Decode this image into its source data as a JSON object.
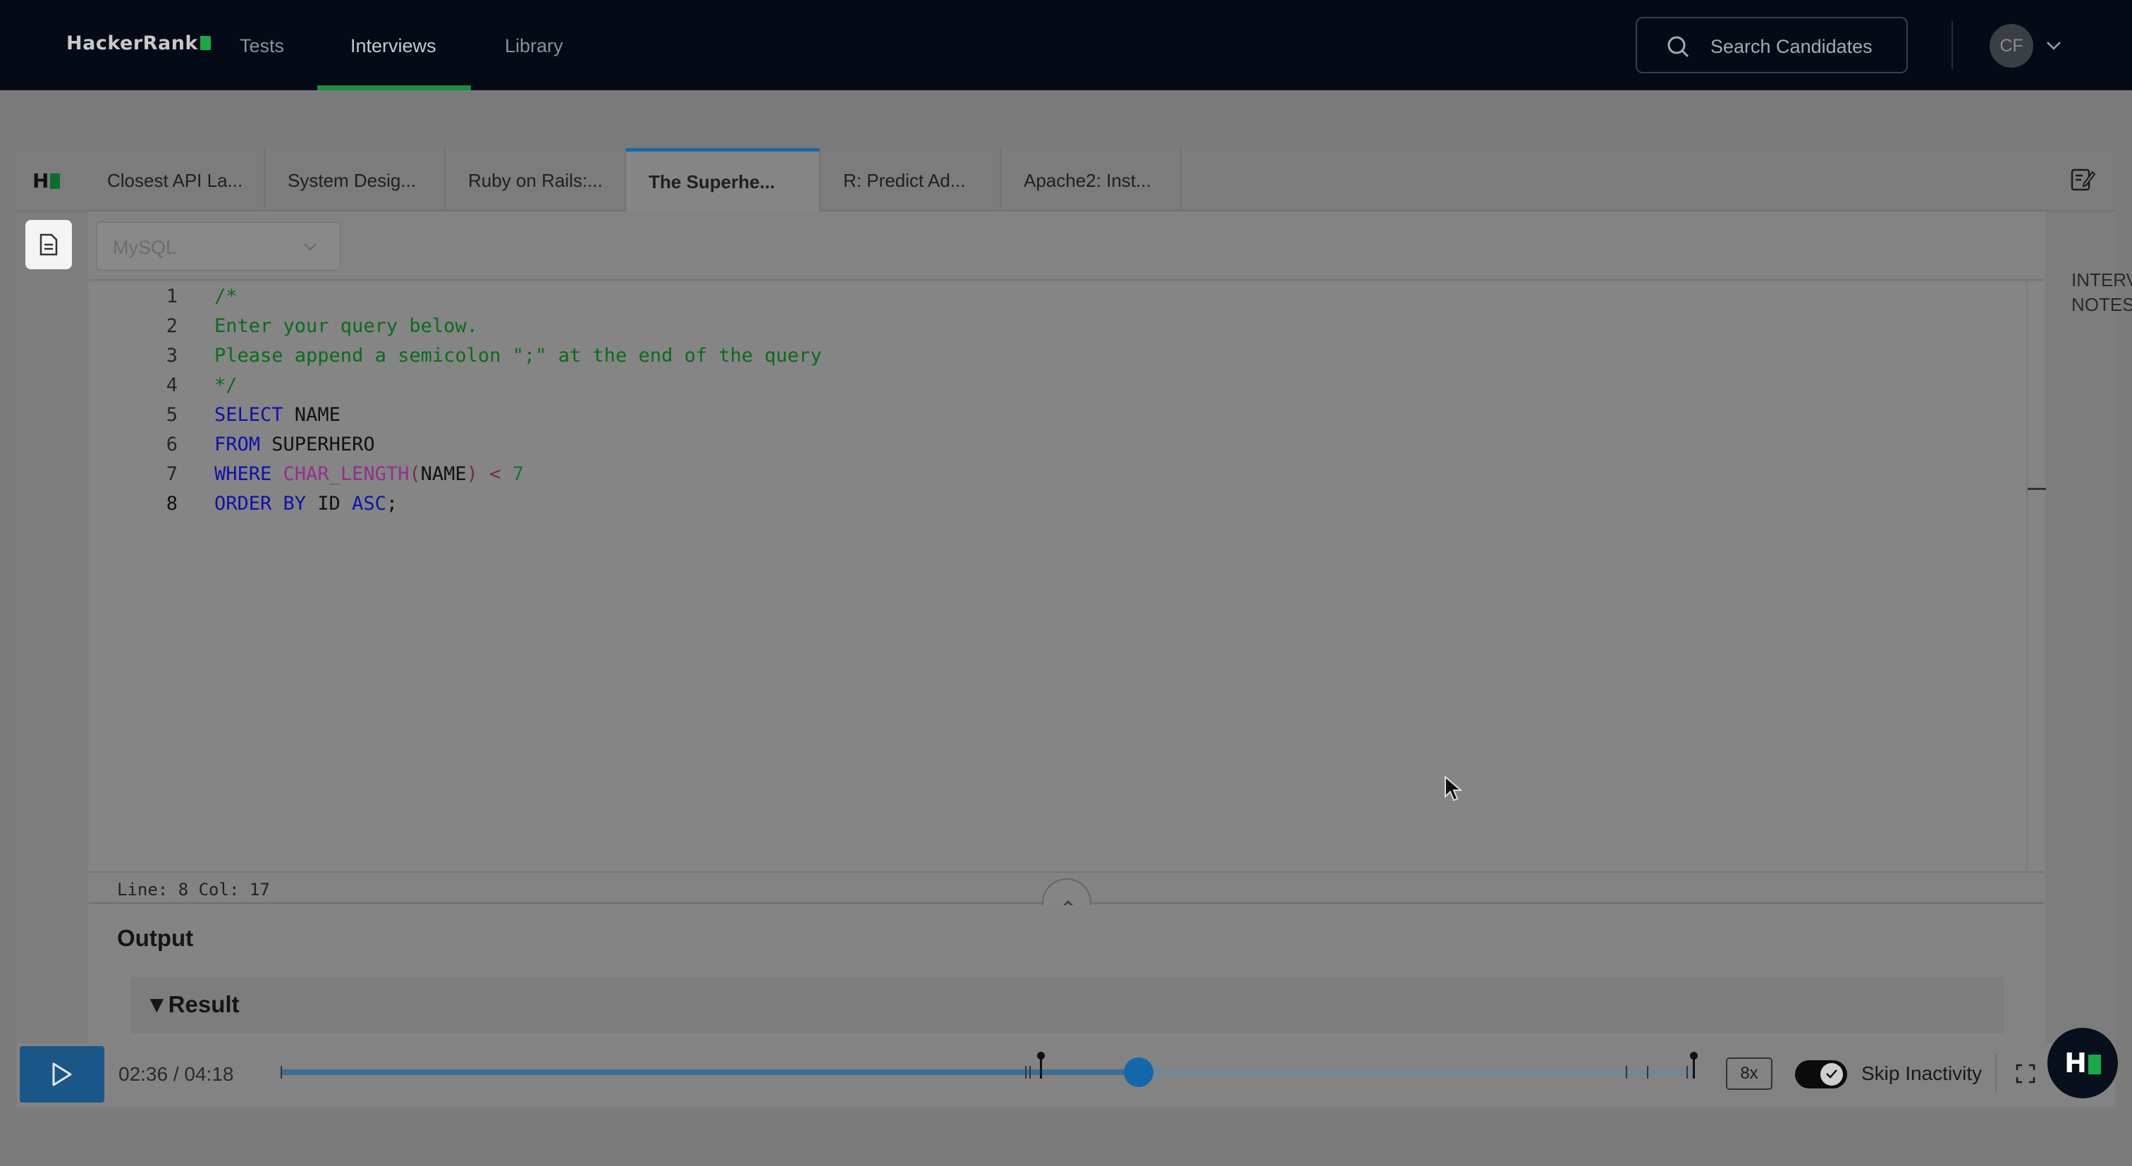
{
  "topnav": {
    "logo": "HackerRank",
    "links": [
      "Tests",
      "Interviews",
      "Library"
    ],
    "active_link": "Interviews",
    "search_placeholder": "Search Candidates",
    "avatar_initials": "CF"
  },
  "tabs": [
    {
      "label": "Closest API La..."
    },
    {
      "label": "System Desig..."
    },
    {
      "label": "Ruby on Rails:..."
    },
    {
      "label": "The Superhe...",
      "active": true
    },
    {
      "label": "R: Predict Ad..."
    },
    {
      "label": "Apache2: Inst..."
    }
  ],
  "editor": {
    "language": "MySQL",
    "lines": [
      {
        "n": "1",
        "text": "/*"
      },
      {
        "n": "2",
        "text": "Enter your query below."
      },
      {
        "n": "3",
        "text": "Please append a semicolon \";\" at the end of the query"
      },
      {
        "n": "4",
        "text": "*/"
      },
      {
        "n": "5",
        "kw1": "SELECT",
        "rest": " NAME"
      },
      {
        "n": "6",
        "kw1": "FROM",
        "rest": " SUPERHERO"
      },
      {
        "n": "7",
        "kw1": "WHERE",
        "fn": "CHAR_LENGTH",
        "arg": "NAME",
        "op": " < ",
        "num": "7"
      },
      {
        "n": "8",
        "kw1": "ORDER BY",
        "id": " ID ",
        "kw2": "ASC",
        "end": ";"
      }
    ],
    "status": "Line: 8 Col: 17"
  },
  "notes_rail_label": "INTERVIEWER NOTES",
  "output": {
    "title": "Output",
    "result_label": "Result"
  },
  "player": {
    "time": "02:36 / 04:18",
    "progress_fraction": 0.605,
    "speed": "8x",
    "skip_inactivity_label": "Skip Inactivity",
    "skip_inactivity_on": true
  },
  "colors": {
    "accent_green": "#1aa84a",
    "play_blue": "#1a5788",
    "knob_blue": "#1467ad",
    "active_tab_line": "#1669a8"
  }
}
